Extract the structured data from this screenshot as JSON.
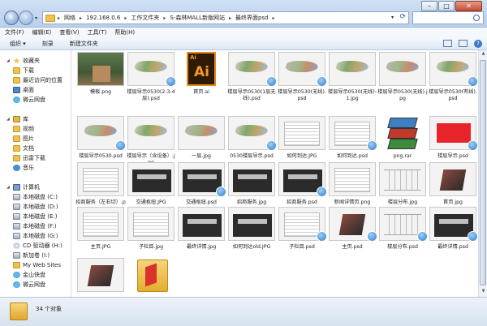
{
  "window": {
    "minimize_symbol": "–",
    "maximize_symbol": "□",
    "close_symbol": "✕"
  },
  "address": {
    "crumbs": [
      "网络",
      "192.168.0.6",
      "工作文件夹",
      "S-森林MALL新版网站",
      "最终界面psd"
    ],
    "search_placeholder": ""
  },
  "menu": [
    "文件(F)",
    "编辑(E)",
    "查看(V)",
    "工具(T)",
    "帮助(H)"
  ],
  "toolbar": {
    "organize": "组织 ▾",
    "burn": "刻录",
    "new_folder": "新建文件夹"
  },
  "sidebar": {
    "favorites_label": "收藏夹",
    "favorites": [
      "下载",
      "最近访问的位置",
      "桌面",
      "微云网盘"
    ],
    "libraries_label": "库",
    "libraries": [
      "视频",
      "图片",
      "文档",
      "迅雷下载",
      "音乐"
    ],
    "computer_label": "计算机",
    "drives": [
      "本地磁盘 (C:)",
      "本地磁盘 (D:)",
      "本地磁盘 (E:)",
      "本地磁盘 (F:)",
      "本地磁盘 (G:)",
      "CD 驱动器 (H:)",
      "新加卷 (I:)",
      "My Web Sites",
      "金山快盘",
      "微云网盘"
    ]
  },
  "files": [
    {
      "name": "模板.png",
      "kind": "photo"
    },
    {
      "name": "楼层导示0530(2-3-4层).psd",
      "kind": "map"
    },
    {
      "name": "首页.ai",
      "kind": "ai"
    },
    {
      "name": "楼层导示0530(1层无线).psd",
      "kind": "map"
    },
    {
      "name": "楼层导示0530(无线).psd",
      "kind": "map"
    },
    {
      "name": "楼层导示0530(无线)-1.jpg",
      "kind": "map"
    },
    {
      "name": "楼层导示0530(无线).jpg",
      "kind": "map"
    },
    {
      "name": "楼层导示0530(有线).psd",
      "kind": "map"
    },
    {
      "name": "楼层导示0530.psd",
      "kind": "map"
    },
    {
      "name": "楼层导示（含设备）.jpg",
      "kind": "map"
    },
    {
      "name": "一层.jpg",
      "kind": "map"
    },
    {
      "name": "0530楼层导示.psd",
      "kind": "map"
    },
    {
      "name": "如何到达.JPG",
      "kind": "doc"
    },
    {
      "name": "如何到达.psd",
      "kind": "doc"
    },
    {
      "name": "png.rar",
      "kind": "rar"
    },
    {
      "name": "楼层导示.psd",
      "kind": "red"
    },
    {
      "name": "招商服务（左右切）.png",
      "kind": "doc"
    },
    {
      "name": "交通枢纽.JPG",
      "kind": "dark"
    },
    {
      "name": "交通枢纽.psd",
      "kind": "dark"
    },
    {
      "name": "招商服务.jpg",
      "kind": "dark"
    },
    {
      "name": "招商服务.psd",
      "kind": "dark"
    },
    {
      "name": "新闻详情页.png",
      "kind": "doc"
    },
    {
      "name": "楼层分布.jpg",
      "kind": "lines"
    },
    {
      "name": "首页.jpg",
      "kind": "bld"
    },
    {
      "name": "主页.JPG",
      "kind": "doc"
    },
    {
      "name": "子栏目.jpg",
      "kind": "doc"
    },
    {
      "name": "最终详情.jpg",
      "kind": "dark"
    },
    {
      "name": "如何到达old.JPG",
      "kind": "dark"
    },
    {
      "name": "子栏目.psd",
      "kind": "doc"
    },
    {
      "name": "主页.psd",
      "kind": "bld"
    },
    {
      "name": "楼层分布.psd",
      "kind": "lines"
    },
    {
      "name": "最终详情.psd",
      "kind": "dark"
    },
    {
      "name": "",
      "kind": "bld"
    },
    {
      "name": "",
      "kind": "folder"
    }
  ],
  "status": {
    "count": "34 个对象"
  }
}
